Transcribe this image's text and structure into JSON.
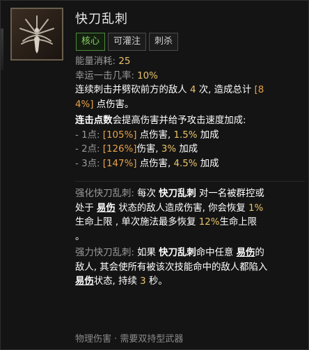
{
  "skill": {
    "title": "快刀乱刺",
    "tags": [
      "核心",
      "可灌注",
      "刺杀"
    ]
  },
  "stats": {
    "resource_label": "能量消耗:",
    "resource_value": "25",
    "luck_label": "幸运一击几率:",
    "luck_value": "10%"
  },
  "description": {
    "d1a": "连续刺击并劈砍前方的敌人",
    "d1_hits": "4",
    "d1b": "次, 造成总计",
    "d1_pct1": "[8",
    "d2_pct2": "4%]",
    "d2_tail": "点伤害。"
  },
  "combo": {
    "header_bright": "连击点数",
    "header_rest": "会提高伤害并给予攻击速度加成:",
    "rows": [
      {
        "prefix": "- 1点:",
        "dmg": "[105%]",
        "dmg_text": "点伤害,",
        "speed": "1.5%",
        "bonus_text": "加成"
      },
      {
        "prefix": "- 2点:",
        "dmg": "[126%]",
        "dmg_text": "伤害,",
        "speed": "3%",
        "bonus_text": "加成"
      },
      {
        "prefix": "- 3点:",
        "dmg": "[147%]",
        "dmg_text": "点伤害,",
        "speed": "4.5%",
        "bonus_text": "加成"
      }
    ]
  },
  "enhanced": {
    "label": "强化快刀乱刺:",
    "t1": "每次",
    "skill_name": "快刀乱刺",
    "t2": "对一名被群控或",
    "t3": "处于",
    "vulnerable": "易伤",
    "t4": "状态的敌人造成伤害, 你会恢复",
    "heal": "1%",
    "t5": "生命上限 , 单次施法最多恢复",
    "max_heal": "12%",
    "t6": "生命上限",
    "t7": "。"
  },
  "improved": {
    "label": "强力快刀乱刺:",
    "t1": "如果",
    "skill_name": "快刀乱刺",
    "t2": "命中任意",
    "vulnerable": "易伤",
    "t3": "的",
    "t4": "敌人, 其会使所有被该次技能命中的敌人都陷入",
    "vulnerable2": "易伤",
    "t5": "状态, 持续",
    "duration": "3",
    "t6": "秒。"
  },
  "footer": {
    "text": "物理伤害 · 需要双持型武器"
  }
}
